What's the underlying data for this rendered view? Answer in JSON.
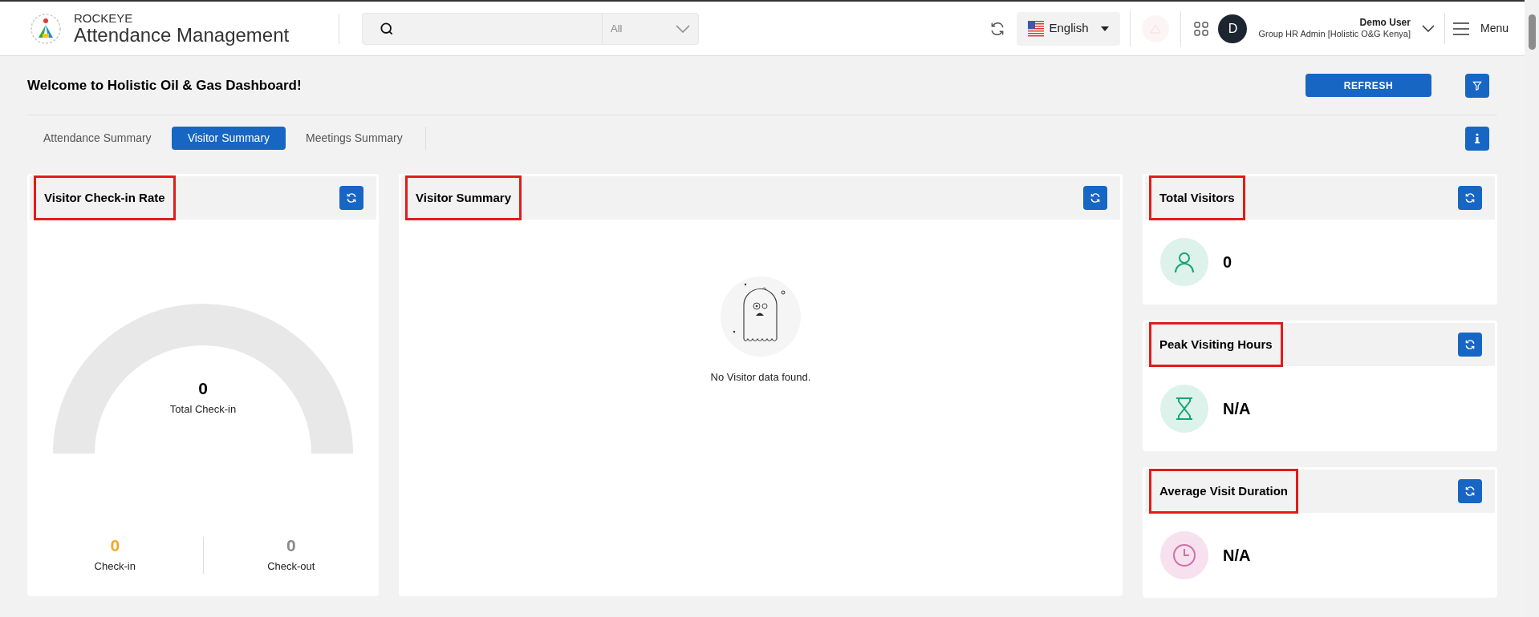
{
  "header": {
    "brand": "ROCKEYE",
    "title": "Attendance Management",
    "search": {
      "filter": "All"
    },
    "language": "English",
    "user": {
      "initial": "D",
      "name": "Demo User",
      "role": "Group HR Admin [Holistic O&G Kenya]"
    },
    "menu": "Menu"
  },
  "welcome": "Welcome to Holistic Oil & Gas Dashboard!",
  "refresh_button": "REFRESH",
  "tabs": [
    {
      "label": "Attendance Summary",
      "selected": false
    },
    {
      "label": "Visitor Summary",
      "selected": true
    },
    {
      "label": "Meetings Summary",
      "selected": false
    }
  ],
  "checkin_card": {
    "title": "Visitor Check-in Rate",
    "highlighted": true,
    "gauge": {
      "value": "0",
      "label": "Total Check-in"
    },
    "stats": [
      {
        "value": "0",
        "label": "Check-in",
        "color": "#f0a928"
      },
      {
        "value": "0",
        "label": "Check-out",
        "color": "#8a8a8a"
      }
    ]
  },
  "summary_card": {
    "title": "Visitor Summary",
    "highlighted": true,
    "empty_message": "No Visitor data found."
  },
  "stat_cards": [
    {
      "title": "Total Visitors",
      "highlighted": true,
      "kind": "person",
      "value": "0"
    },
    {
      "title": "Peak Visiting Hours",
      "highlighted": true,
      "kind": "hourglass",
      "value": "N/A"
    },
    {
      "title": "Average Visit Duration",
      "highlighted": true,
      "kind": "clock",
      "value": "N/A"
    }
  ]
}
